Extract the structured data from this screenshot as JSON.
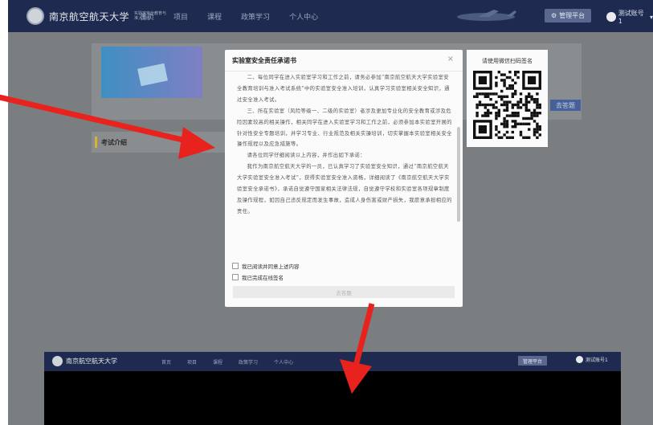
{
  "header": {
    "logo_text": "南京航空航天大学",
    "logo_sub": "实验室安全教育与准入系统",
    "nav": [
      "首页",
      "项目",
      "课程",
      "政策学习",
      "个人中心"
    ],
    "mgmt_label": "管理平台",
    "user_label": "测试账号1"
  },
  "main": {
    "exam_button": "去答题",
    "intro_label": "考试介绍"
  },
  "modal": {
    "title": "实验室安全责任承诺书",
    "close": "×",
    "paragraphs": [
      "二、每位同学在进入实验室学习和工作之前，请务必参加“南京航空航天大学实验室安全教育培训与准入考试系统”中的实验室安全准入培训，认真学习实验室相关安全知识，通过安全准入考试。",
      "三、所在实验室（风险等级一、二级的实验室）者涉及更加专业化的安全教育或涉及危险因素较高的相关操作，相关同学在进入实验室学习和工作之前，必须参加本实验室开展的针对性安全专题培训，并学习专业、行业规范及相关实操培训，切实掌握本实验室相关安全操作规程以及应急措施等。",
      "请各位同学仔细阅读以上内容，并作出如下承诺：",
      "我作为南京航空航天大学的一员，已认真学习了实验室安全知识，通过“南京航空航天大学实验室安全准入考试”，获得实验室安全准入资格，详细阅读了《南京航空航天大学实验室安全承诺书》，承诺自觉遵守国家相关法律法规，自觉遵守学校和实验室各项规章制度及操作规程，如因自己违反规定而发生事故，造成人身伤害或财产损失，我愿意承担相应的责任。"
    ],
    "check1": "我已阅读并同意上述内容",
    "check2": "我已完成在线签名",
    "button": "去答题"
  },
  "qr_panel": {
    "title": "请使用微信扫码签名"
  },
  "bottom": {
    "logo_text": "南京航空航天大学",
    "nav": [
      "首页",
      "项目",
      "课程",
      "政策学习",
      "个人中心"
    ],
    "mgmt_label": "管理平台",
    "user_label": "测试账号1"
  },
  "colors": {
    "nav_bg": "#1e2a4f",
    "overlay": "#7b7e80",
    "arrow": "#e8231d"
  }
}
